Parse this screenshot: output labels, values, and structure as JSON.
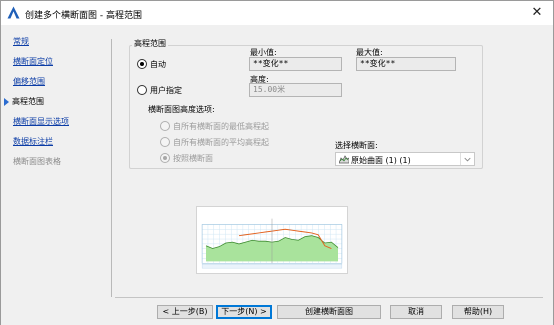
{
  "window": {
    "title": "创建多个横断面图 - 高程范围",
    "close_glyph": "✕"
  },
  "nav": {
    "items": [
      {
        "label": "常规",
        "state": "link"
      },
      {
        "label": "横断面定位",
        "state": "link"
      },
      {
        "label": "偏移范围",
        "state": "link"
      },
      {
        "label": "高程范围",
        "state": "active"
      },
      {
        "label": "横断面显示选项",
        "state": "link"
      },
      {
        "label": "数据标注栏",
        "state": "link"
      },
      {
        "label": "横断面图表格",
        "state": "disabled"
      }
    ]
  },
  "elevation": {
    "group_title": "高程范围",
    "auto_label": "自动",
    "user_label": "用户指定",
    "min_label": "最小值:",
    "min_value": "**变化**",
    "max_label": "最大值:",
    "max_value": "**变化**",
    "height_label": "高度:",
    "height_value": "15.00米",
    "options_label": "横断面图高度选项:",
    "options": [
      "自所有横断面的最低高程起",
      "自所有横断面的平均高程起",
      "按照横断面"
    ],
    "select_label": "选择横断面:",
    "select_value": "原始曲面 (1) (1)"
  },
  "preview": {
    "caption": "",
    "ground_profile": [
      17,
      14,
      16,
      20,
      21,
      19,
      21,
      23,
      22,
      22,
      21,
      22,
      26,
      24,
      23,
      27,
      28,
      26,
      20,
      21,
      15
    ],
    "design_profile": [
      null,
      null,
      null,
      null,
      null,
      28,
      29,
      30,
      31,
      32,
      33,
      34,
      35,
      34,
      33,
      32,
      31,
      29,
      17,
      14,
      null
    ]
  },
  "buttons": {
    "back": "< 上一步(B)",
    "next": "下一步(N) >",
    "create": "创建横断面图",
    "cancel": "取消",
    "help": "帮助(H)"
  },
  "colors": {
    "link": "#0b3ca6",
    "nav_arrow": "#2b6cd0",
    "ground_fill": "#a9e39c",
    "ground_line": "#3c8a2e",
    "design_line": "#e3621f",
    "grid": "#cfe6f5",
    "default_button_border": "#0078d7"
  }
}
